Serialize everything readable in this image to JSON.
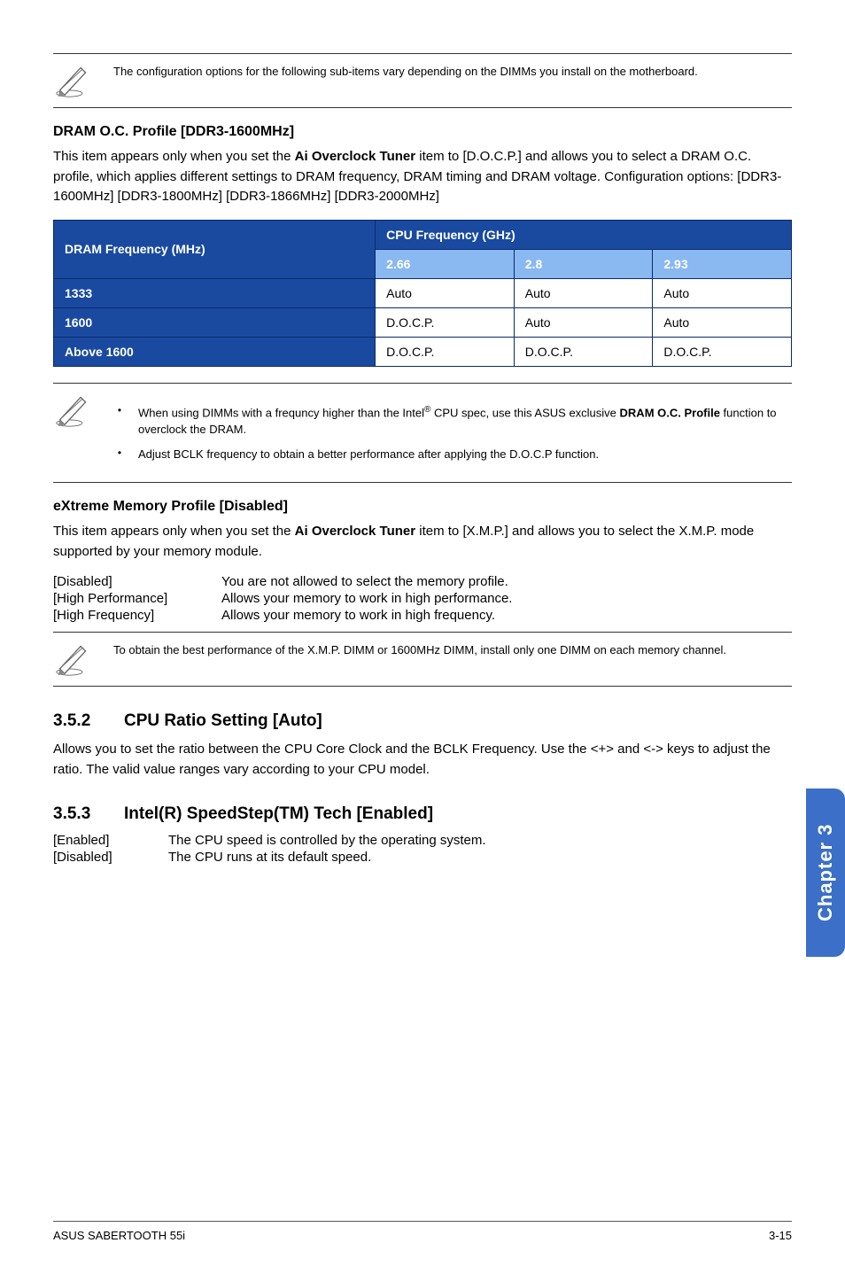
{
  "note_top": "The configuration options for the following sub-items vary depending on the DIMMs you install on the motherboard.",
  "dram_profile": {
    "heading": "DRAM O.C. Profile [DDR3-1600MHz]",
    "para": "This item appears only when you set the <b>Ai Overclock Tuner</b> item to [D.O.C.P.] and allows you to select a DRAM O.C. profile, which applies different settings to DRAM frequency, DRAM timing and DRAM voltage. Configuration options:  [DDR3-1600MHz] [DDR3-1800MHz] [DDR3-1866MHz] [DDR3-2000MHz]"
  },
  "chart_data": {
    "type": "table",
    "row_header_label": "DRAM Frequency (MHz)",
    "col_header_label": "CPU Frequency (GHz)",
    "columns": [
      "2.66",
      "2.8",
      "2.93"
    ],
    "rows": [
      {
        "label": "1333",
        "cells": [
          "Auto",
          "Auto",
          "Auto"
        ]
      },
      {
        "label": "1600",
        "cells": [
          "D.O.C.P.",
          "Auto",
          "Auto"
        ]
      },
      {
        "label": "Above 1600",
        "cells": [
          "D.O.C.P.",
          "D.O.C.P.",
          "D.O.C.P."
        ]
      }
    ]
  },
  "bullets_mid": [
    "When using DIMMs with a frequncy higher than the Intel<sup>®</sup> CPU spec, use this ASUS exclusive <b>DRAM O.C. Profile</b> function to overclock the DRAM.",
    "Adjust BCLK frequency to obtain a better performance after applying the D.O.C.P function."
  ],
  "xmp": {
    "heading": "eXtreme Memory Profile [Disabled]",
    "para": "This item appears only when you set the <b>Ai Overclock Tuner</b> item to [X.M.P.] and allows you to select the X.M.P. mode supported by your memory module.",
    "options": [
      {
        "k": "[Disabled]",
        "v": "You are not allowed to select the memory profile."
      },
      {
        "k": "[High Performance]",
        "v": "Allows your memory to work in high performance."
      },
      {
        "k": "[High Frequency]",
        "v": "Allows your memory to work in high frequency."
      }
    ],
    "note": "To obtain the best performance of the X.M.P. DIMM or 1600MHz DIMM, install only one DIMM on each memory channel."
  },
  "s352": {
    "num": "3.5.2",
    "title": "CPU Ratio Setting [Auto]",
    "para": "Allows you to set the ratio between the CPU Core Clock and the BCLK Frequency. Use the <+> and <-> keys to adjust the ratio. The valid value ranges vary according to your CPU model."
  },
  "s353": {
    "num": "3.5.3",
    "title": "Intel(R) SpeedStep(TM) Tech [Enabled]",
    "options": [
      {
        "k": "[Enabled]",
        "v": "The CPU speed is controlled by the operating system."
      },
      {
        "k": "[Disabled]",
        "v": "The CPU runs at its default speed."
      }
    ]
  },
  "side_tab": "Chapter 3",
  "footer_left": "ASUS SABERTOOTH 55i",
  "footer_right": "3-15"
}
